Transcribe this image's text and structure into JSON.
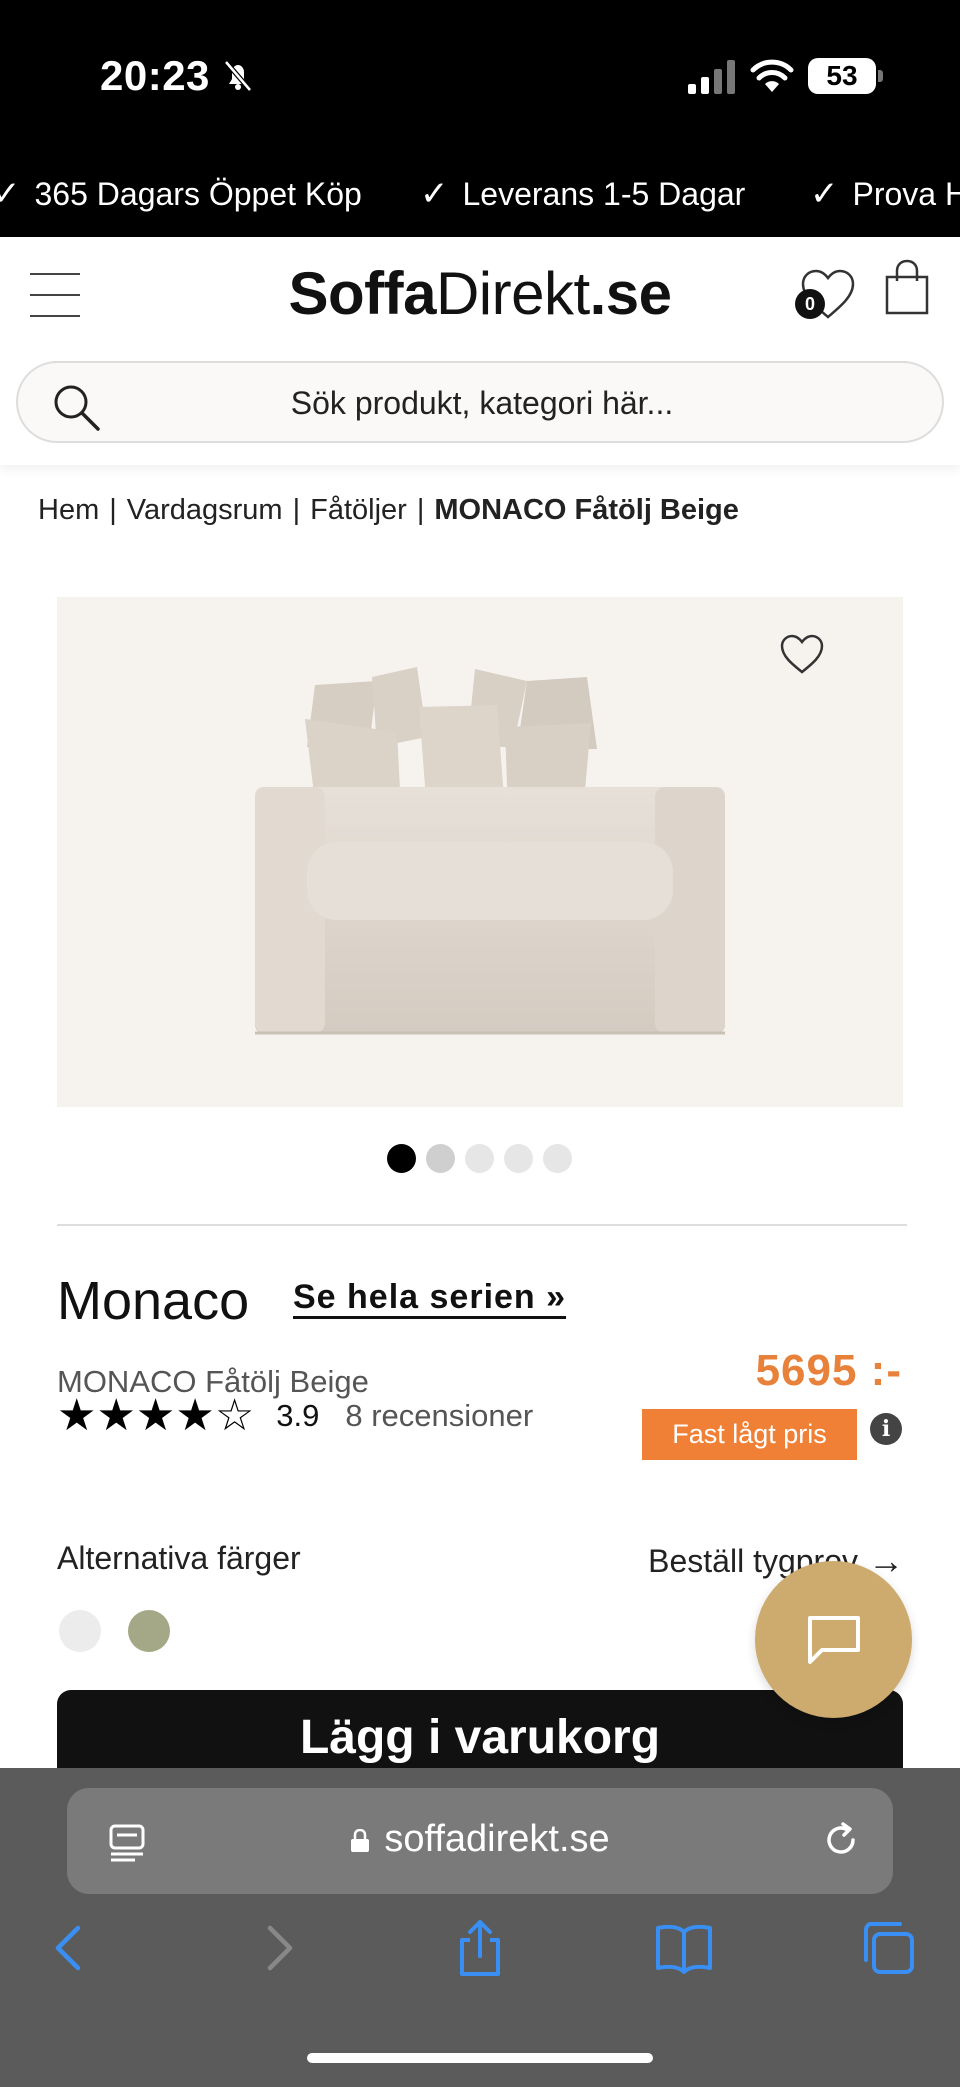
{
  "status_bar": {
    "time": "20:23",
    "battery": "53"
  },
  "usp_bar": {
    "items": [
      "365 Dagars Öppet Köp",
      "Leverans 1-5 Dagar",
      "Prova H"
    ]
  },
  "header": {
    "logo_bold": "Soffa",
    "logo_light": "Direkt",
    "logo_tld": ".se",
    "wishlist_count": "0",
    "search_placeholder": "Sök produkt, kategori här..."
  },
  "breadcrumb": {
    "items": [
      "Hem",
      "Vardagsrum",
      "Fåtöljer"
    ],
    "current": "MONACO Fåtölj Beige",
    "separator": "|"
  },
  "gallery": {
    "image_count": 5,
    "active_index": 0
  },
  "product": {
    "name": "Monaco",
    "series_link": "Se hela serien »",
    "subtitle": "MONACO Fåtölj Beige",
    "rating_stars": 3.9,
    "rating_text": "3.9",
    "reviews": "8 recensioner",
    "price": "5695 :-",
    "price_badge": "Fast lågt pris",
    "price_color": "#e8823a",
    "info_label": "i"
  },
  "colors": {
    "label": "Alternativa färger",
    "fabric_link": "Beställ tygprov",
    "swatches": [
      "#ececec",
      "#a5a886"
    ]
  },
  "actions": {
    "add_to_cart": "Lägg i varukorg"
  },
  "browser": {
    "url": "soffadirekt.se"
  }
}
